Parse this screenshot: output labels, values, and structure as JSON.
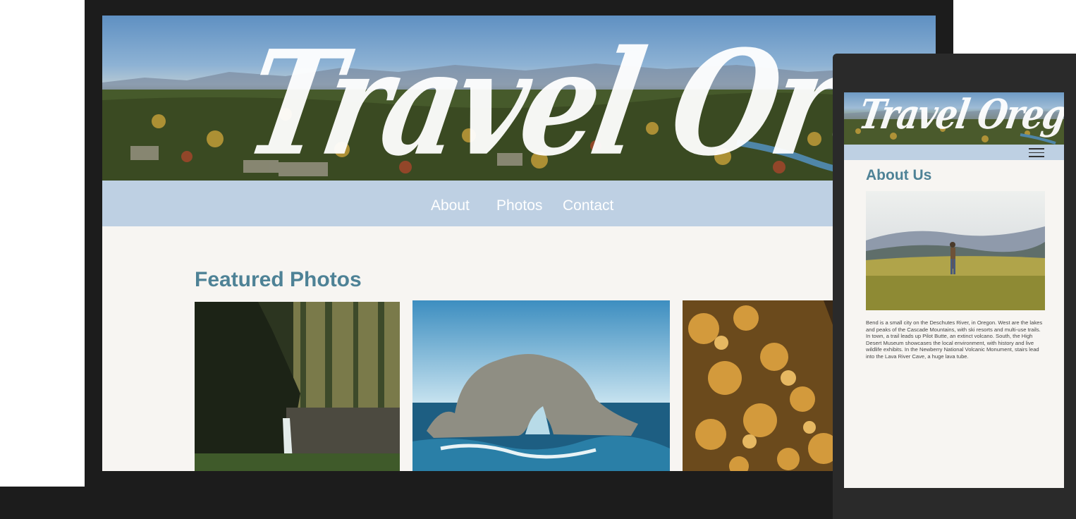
{
  "site": {
    "logo_text": "Travel Oregon"
  },
  "desktop": {
    "nav": {
      "links": [
        {
          "label": "About"
        },
        {
          "label": "Photos"
        },
        {
          "label": "Contact"
        }
      ]
    },
    "featured": {
      "title": "Featured Photos",
      "photos": [
        {
          "name": "waterfall-forest-photo"
        },
        {
          "name": "sea-arch-rock-photo"
        },
        {
          "name": "autumn-leaves-photo"
        }
      ]
    }
  },
  "mobile": {
    "menu_icon": "hamburger-menu-icon",
    "about": {
      "title": "About Us",
      "body": "Bend is  a small city on the Deschutes River, in Oregon. West are the lakes and peaks of the Cascade Mountains, with ski resorts and multi-use trails. In town, a trail leads up Pilot Butte, an extinct volcano. South, the High Desert Museum showcases the local environment, with history and live wildlife exhibits. In the Newberry National Volcanic Monument, stairs lead into the Lava River Cave, a huge lava tube."
    }
  },
  "colors": {
    "accent_heading": "#4e8296",
    "nav_background": "#bed0e3",
    "page_background": "#f7f5f2",
    "device_frame": "#1c1c1c"
  }
}
